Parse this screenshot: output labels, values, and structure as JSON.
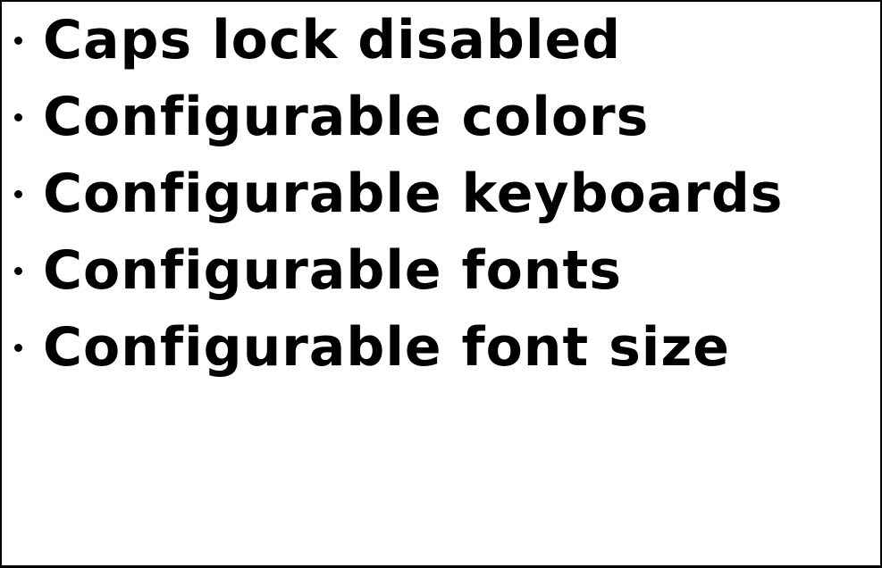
{
  "features": {
    "items": [
      {
        "label": "Caps lock disabled"
      },
      {
        "label": "Configurable colors"
      },
      {
        "label": "Configurable keyboards"
      },
      {
        "label": "Configurable fonts"
      },
      {
        "label": "Configurable font size"
      }
    ]
  },
  "colors": {
    "text": "#000000",
    "background": "#ffffff",
    "border": "#000000"
  }
}
